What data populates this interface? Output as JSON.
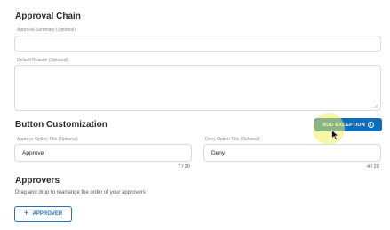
{
  "approval_chain": {
    "heading": "Approval Chain",
    "summary_label": "Approval Summary (Optional)",
    "summary_value": "",
    "reason_label": "Default Reason (Optional)",
    "reason_value": ""
  },
  "button_customization": {
    "heading": "Button Customization",
    "add_exception_label": "ADD EXCEPTION",
    "info_glyph": "i",
    "approve_label": "Approve Option Title (Optional)",
    "approve_value": "Approve",
    "approve_count": "7 / 20",
    "deny_label": "Deny Option Title (Optional)",
    "deny_value": "Deny",
    "deny_count": "4 / 20"
  },
  "approvers": {
    "heading": "Approvers",
    "helper_text": "Drag and drop to rearrange the order of your approvers",
    "add_approver_icon": "+",
    "add_approver_label": "APPROVER"
  },
  "colors": {
    "accent": "#0f6dbd",
    "border": "#d6dbe0",
    "highlight": "#f0ee5a"
  }
}
